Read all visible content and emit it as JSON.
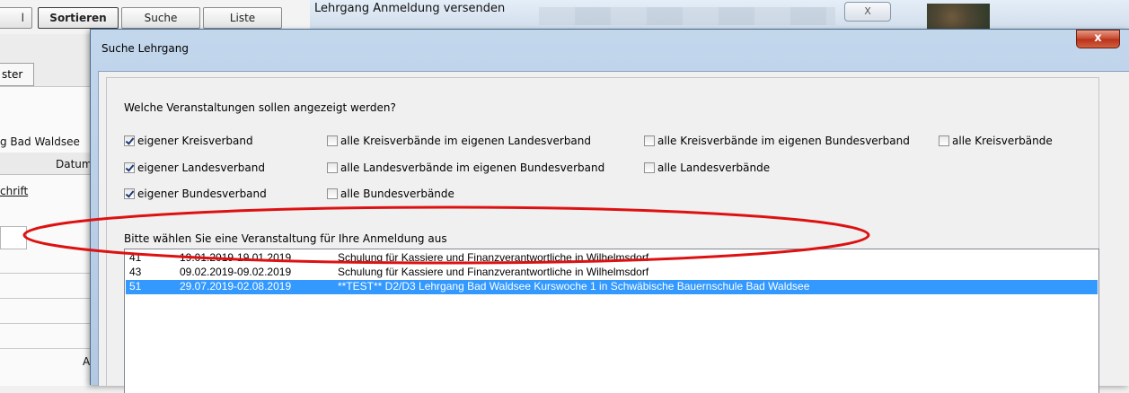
{
  "background": {
    "toolbar": {
      "partial_button_label": "l",
      "sort_label": "Sortieren",
      "search_label": "Suche",
      "list_label": "Liste"
    },
    "window_title": "Lehrgang Anmeldung versenden",
    "close_label": "X",
    "tab_label": "ster",
    "location_text": "g Bad Waldsee",
    "column_date": "Datum",
    "link_text": "chrift",
    "footer_letter": "A"
  },
  "dialog": {
    "title": "Suche Lehrgang",
    "close_glyph": "x",
    "question": "Welche Veranstaltungen sollen angezeigt werden?",
    "checkboxes": [
      {
        "label": "eigener Kreisverband",
        "checked": true
      },
      {
        "label": "alle Kreisverbände im eigenen Landesverband",
        "checked": false
      },
      {
        "label": "alle Kreisverbände im eigenen Bundesverband",
        "checked": false
      },
      {
        "label": "alle Kreisverbände",
        "checked": false
      },
      {
        "label": "eigener Landesverband",
        "checked": true
      },
      {
        "label": "alle Landesverbände im eigenen Bundesverband",
        "checked": false
      },
      {
        "label": "alle Landesverbände",
        "checked": false
      },
      {
        "label": "eigener Bundesverband",
        "checked": true
      },
      {
        "label": "alle Bundesverbände",
        "checked": false
      }
    ],
    "prompt": "Bitte wählen Sie eine Veranstaltung für Ihre Anmeldung aus",
    "events": [
      {
        "id": "41",
        "dates": "19.01.2019-19.01.2019",
        "title": "Schulung für Kassiere und Finanzverantwortliche in Wilhelmsdorf",
        "selected": false
      },
      {
        "id": "43",
        "dates": "09.02.2019-09.02.2019",
        "title": "Schulung für Kassiere und Finanzverantwortliche in Wilhelmsdorf",
        "selected": false
      },
      {
        "id": "51",
        "dates": "29.07.2019-02.08.2019",
        "title": "**TEST** D2/D3 Lehrgang Bad Waldsee Kurswoche 1 in Schwäbische Bauernschule Bad Waldsee",
        "selected": true
      }
    ]
  },
  "colors": {
    "selection": "#3399ff",
    "highlight_ellipse": "#dd1111",
    "checkmark": "#1f3a7a"
  }
}
